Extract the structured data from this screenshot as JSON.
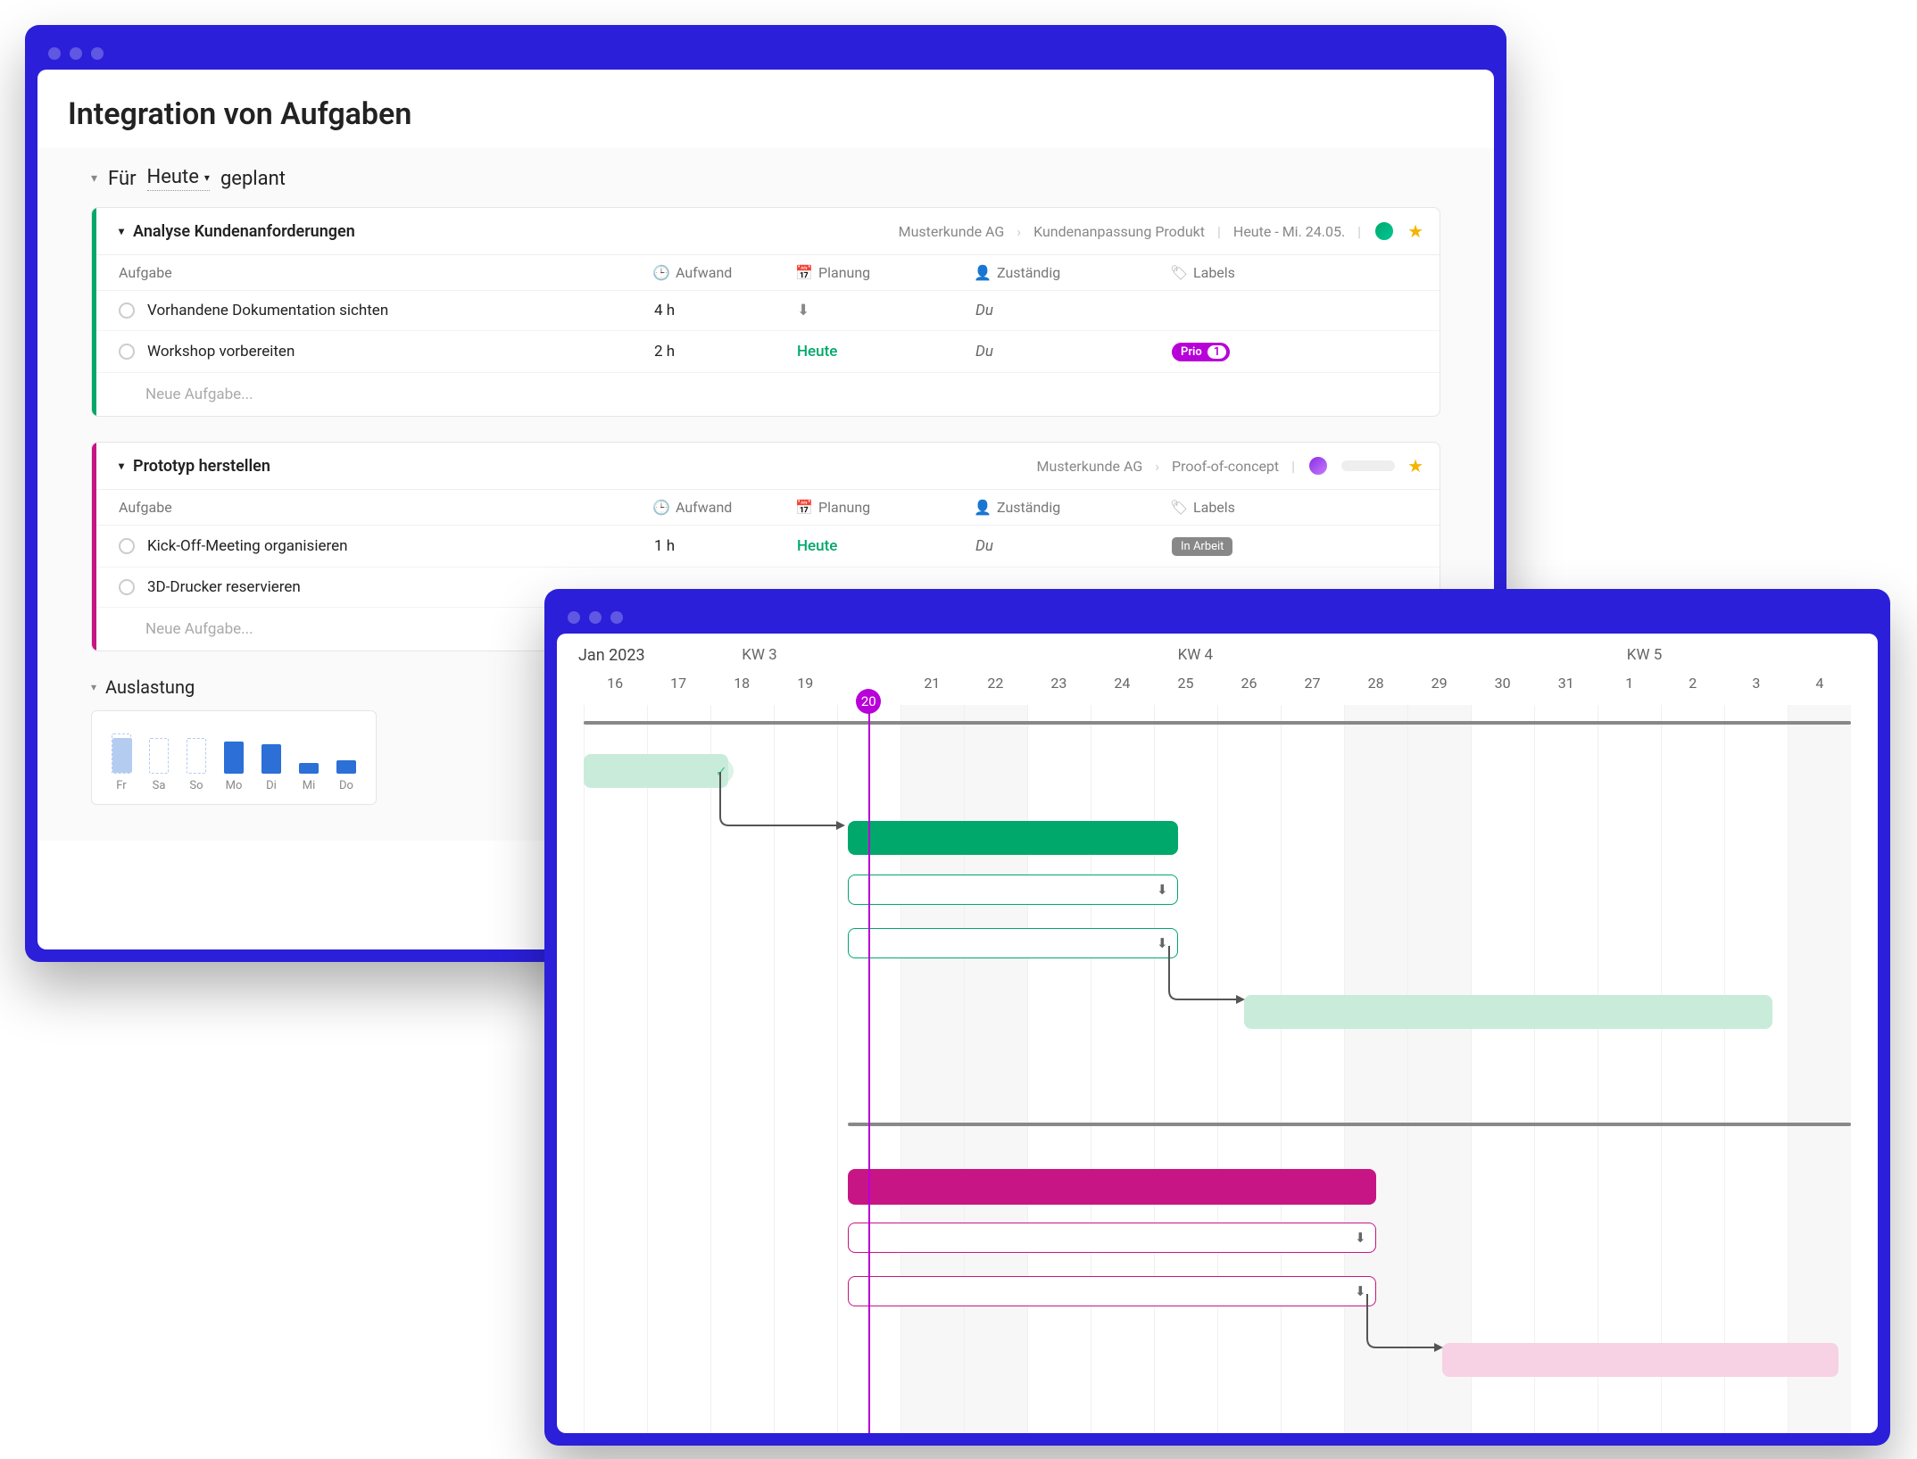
{
  "page": {
    "title": "Integration von Aufgaben"
  },
  "planned": {
    "prefix": "Für",
    "word": "Heute",
    "suffix": "geplant"
  },
  "columns": {
    "task": "Aufgabe",
    "effort": "Aufwand",
    "planning": "Planung",
    "responsible": "Zuständig",
    "labels": "Labels"
  },
  "newTask": "Neue Aufgabe...",
  "groups": [
    {
      "accent": "#00a86b",
      "title": "Analyse Kundenanforderungen",
      "breadcrumb": [
        "Musterkunde AG",
        "Kundenanpassung Produkt"
      ],
      "date": "Heute - Mi. 24.05.",
      "tasks": [
        {
          "name": "Vorhandene Dokumentation sichten",
          "effort": "4 h",
          "planning_type": "inbox",
          "responsible": "Du"
        },
        {
          "name": "Workshop vorbereiten",
          "effort": "2 h",
          "planning_type": "today",
          "planning_label": "Heute",
          "responsible": "Du",
          "label": {
            "type": "prio",
            "text": "Prio",
            "num": "1"
          }
        }
      ]
    },
    {
      "accent": "#c71585",
      "title": "Prototyp herstellen",
      "breadcrumb": [
        "Musterkunde AG",
        "Proof-of-concept"
      ],
      "date": "",
      "tasks": [
        {
          "name": "Kick-Off-Meeting organisieren",
          "effort": "1 h",
          "planning_type": "today",
          "planning_label": "Heute",
          "responsible": "Du",
          "label": {
            "type": "status",
            "text": "In Arbeit"
          }
        },
        {
          "name": "3D-Drucker reservieren",
          "effort": "",
          "planning_type": "",
          "responsible": ""
        }
      ]
    }
  ],
  "auslastung": {
    "title": "Auslastung"
  },
  "chart_data": {
    "type": "bar",
    "categories": [
      "Fr",
      "Sa",
      "So",
      "Mo",
      "Di",
      "Mi",
      "Do"
    ],
    "values": [
      65,
      0,
      0,
      60,
      55,
      20,
      25
    ],
    "placeholder_flags": [
      true,
      true,
      true,
      false,
      false,
      false,
      false
    ],
    "title": "",
    "xlabel": "",
    "ylabel": "",
    "ylim": [
      0,
      100
    ]
  },
  "gantt": {
    "month": "Jan 2023",
    "weeks": [
      {
        "label": "KW 3",
        "posPct": 14
      },
      {
        "label": "KW 4",
        "posPct": 47
      },
      {
        "label": "KW 5",
        "posPct": 81
      }
    ],
    "days": [
      "16",
      "17",
      "18",
      "19",
      "20",
      "21",
      "22",
      "23",
      "24",
      "25",
      "26",
      "27",
      "28",
      "29",
      "30",
      "31",
      "1",
      "2",
      "3",
      "4"
    ],
    "todayIndex": 4,
    "todayLabel": "20"
  }
}
